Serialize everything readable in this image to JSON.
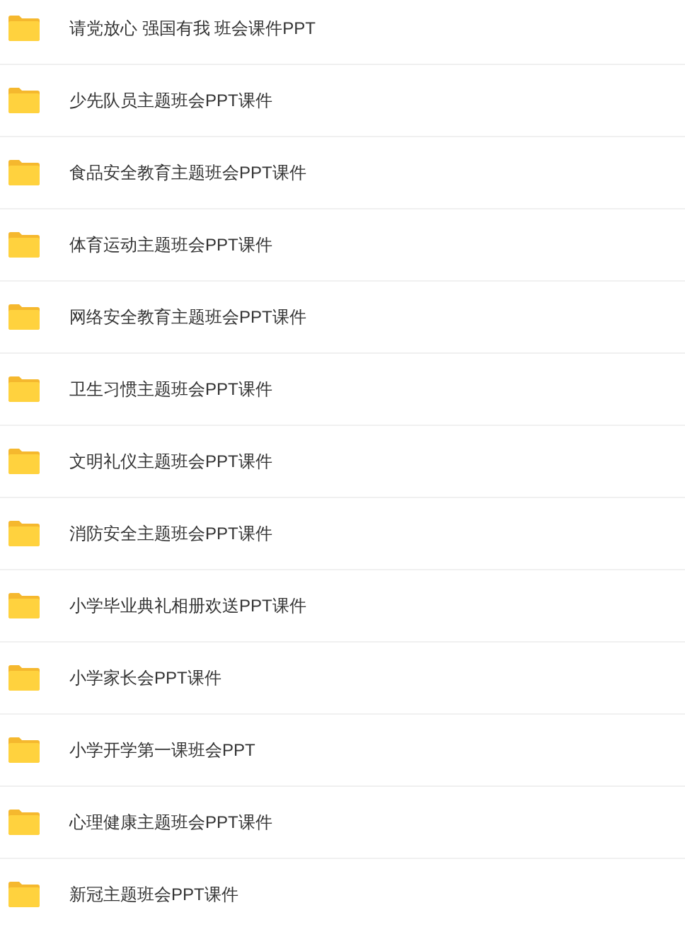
{
  "folders": [
    {
      "name": "请党放心 强国有我 班会课件PPT"
    },
    {
      "name": "少先队员主题班会PPT课件"
    },
    {
      "name": "食品安全教育主题班会PPT课件"
    },
    {
      "name": "体育运动主题班会PPT课件"
    },
    {
      "name": "网络安全教育主题班会PPT课件"
    },
    {
      "name": "卫生习惯主题班会PPT课件"
    },
    {
      "name": "文明礼仪主题班会PPT课件"
    },
    {
      "name": "消防安全主题班会PPT课件"
    },
    {
      "name": "小学毕业典礼相册欢送PPT课件"
    },
    {
      "name": "小学家长会PPT课件"
    },
    {
      "name": "小学开学第一课班会PPT"
    },
    {
      "name": "心理健康主题班会PPT课件"
    },
    {
      "name": "新冠主题班会PPT课件"
    }
  ]
}
